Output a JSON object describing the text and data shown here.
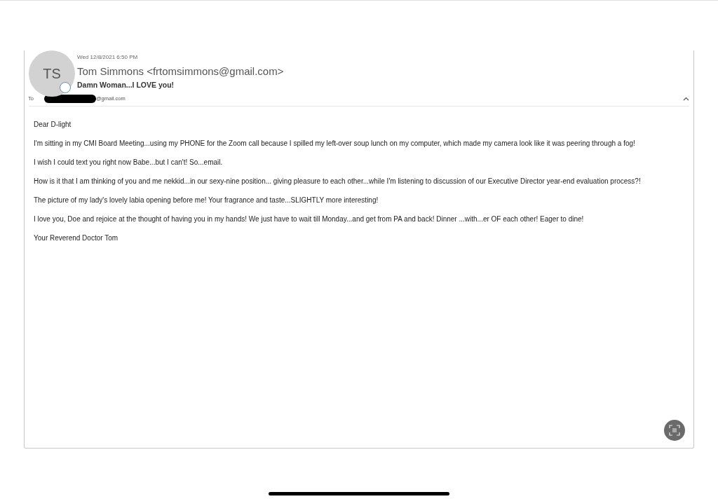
{
  "email": {
    "avatar_initials": "TS",
    "date": "Wed 12/8/2021 6:50 PM",
    "sender": "Tom Simmons <frtomsimmons@gmail.com>",
    "subject": "Damn Woman...I LOVE you!",
    "to_label": "To",
    "to_address": "@gmail.com",
    "to_redacted": true,
    "body": [
      "Dear D-light",
      "I'm sitting in my CMI Board Meeting...using my PHONE for the Zoom call because I spilled my left-over soup lunch on my computer, which made my camera look like it was peering through a fog!",
      "I wish I could text you right now Babe...but I can't!  So...email.",
      "How is it that I am thinking of you and me nekkid...in our sexy-nine position... giving pleasure to each other...while I'm listening to discussion of our Executive Director year-end evaluation process?!",
      "The picture of my lady's lovely labia opening before me!  Your fragrance and taste...SLIGHTLY more interesting!",
      "I love you, Doe and rejoice at the thought of having you in my hands!  We just have to wait till Monday...and get from PA and back!  Dinner ...with...er OF each other!  Eager to dine!",
      "Your Reverend Doctor Tom"
    ]
  }
}
